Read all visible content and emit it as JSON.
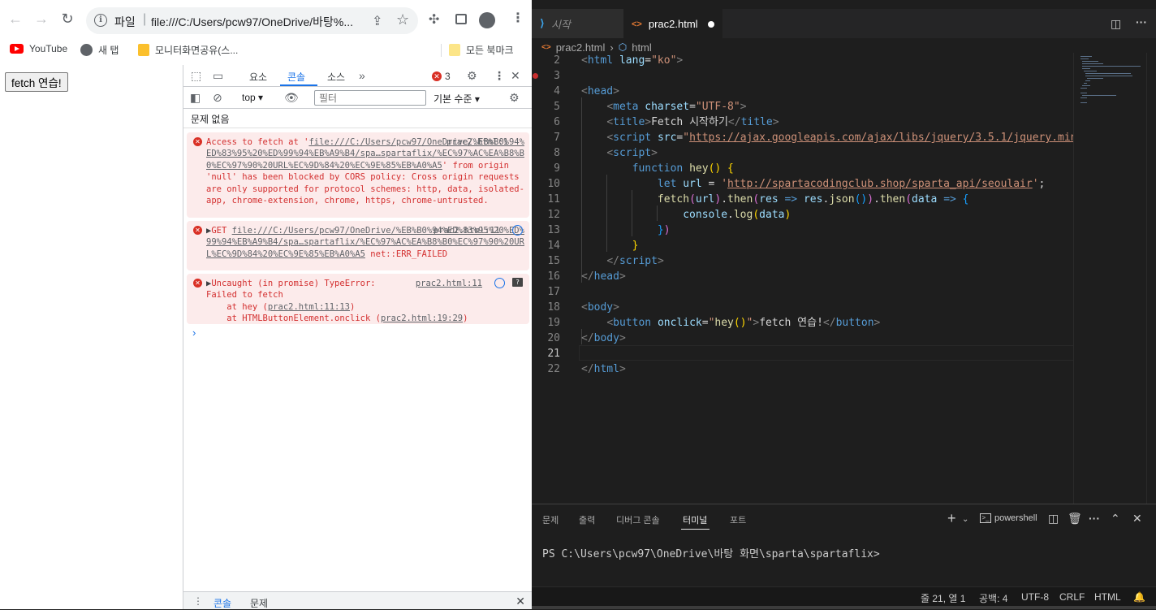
{
  "browser": {
    "omnibox": {
      "scheme_label": "파일",
      "url": "file:///C:/Users/pcw97/OneDrive/바탕%..."
    },
    "bookmarks": [
      {
        "label": "YouTube",
        "icon": "youtube-icon"
      },
      {
        "label": "새 탭",
        "icon": "globe-icon"
      },
      {
        "label": "모니터화면공유(스...",
        "icon": "folder-icon"
      }
    ],
    "all_bookmarks_label": "모든 북마크",
    "page": {
      "button_label": "fetch 연습!"
    }
  },
  "devtools": {
    "tabs": [
      "요소",
      "콘솔",
      "소스"
    ],
    "active_tab": "콘솔",
    "error_count": "3",
    "context": "top",
    "filter_placeholder": "필터",
    "level": "기본 수준",
    "issues": "문제 없음",
    "messages": [
      {
        "text_pre": "Access to fetch at '",
        "link": "file:///C:/Users/pcw97/OneDrive/%EB%B0%94%ED%83%95%20%ED%99%94%EB%A9%B4/spa…spartaflix/%EC%97%AC%EA%B8%B0%EC%97%90%20URL%EC%9D%84%20%EC%9E%85%EB%A0%A5",
        "text_post": "' from origin 'null' has been blocked by CORS policy: Cross origin requests are only supported for protocol schemes: http, data, isolated-app, chrome-extension, chrome, https, chrome-untrusted.",
        "source": "prac2.html:1"
      },
      {
        "method": "GET",
        "link": "file:///C:/Users/pcw97/OneDrive/%EB%B0%94%ED%83%95%20%ED%99%94%EB%A9%B4/spa…spartaflix/%EC%97%AC%EA%B8%B0%EC%97%90%20URL%EC%9D%84%20%EC%9E%85%EB%A0%A5",
        "error": "net::ERR_FAILED",
        "source": "prac2.html:11"
      },
      {
        "line1": "Uncaught (in promise) TypeError:",
        "line2": "Failed to fetch",
        "stack": [
          {
            "prefix": "    at hey (",
            "link": "prac2.html:11:13",
            "suffix": ")"
          },
          {
            "prefix": "    at HTMLButtonElement.onclick (",
            "link": "prac2.html:19:29",
            "suffix": ")"
          }
        ],
        "source": "prac2.html:11"
      }
    ],
    "drawer_tabs": [
      "콘솔",
      "문제"
    ]
  },
  "vscode": {
    "tabs": [
      {
        "label": "시작",
        "active": false
      },
      {
        "label": "prac2.html",
        "active": true,
        "dirty": true
      }
    ],
    "breadcrumbs": [
      "prac2.html",
      "html"
    ],
    "line_numbers": [
      "2",
      "3",
      "4",
      "5",
      "6",
      "7",
      "8",
      "9",
      "10",
      "11",
      "12",
      "13",
      "14",
      "15",
      "16",
      "17",
      "18",
      "19",
      "20",
      "21",
      "22"
    ],
    "current_line": "21",
    "panel_tabs": [
      "문제",
      "출력",
      "디버그 콘솔",
      "터미널",
      "포트"
    ],
    "active_panel_tab": "터미널",
    "terminal_profile": "powershell",
    "terminal_prompt": "PS C:\\Users\\pcw97\\OneDrive\\바탕 화면\\sparta\\spartaflix>",
    "status": {
      "position": "줄 21, 열 1",
      "spaces": "공백: 4",
      "encoding": "UTF-8",
      "eol": "CRLF",
      "language": "HTML"
    }
  }
}
